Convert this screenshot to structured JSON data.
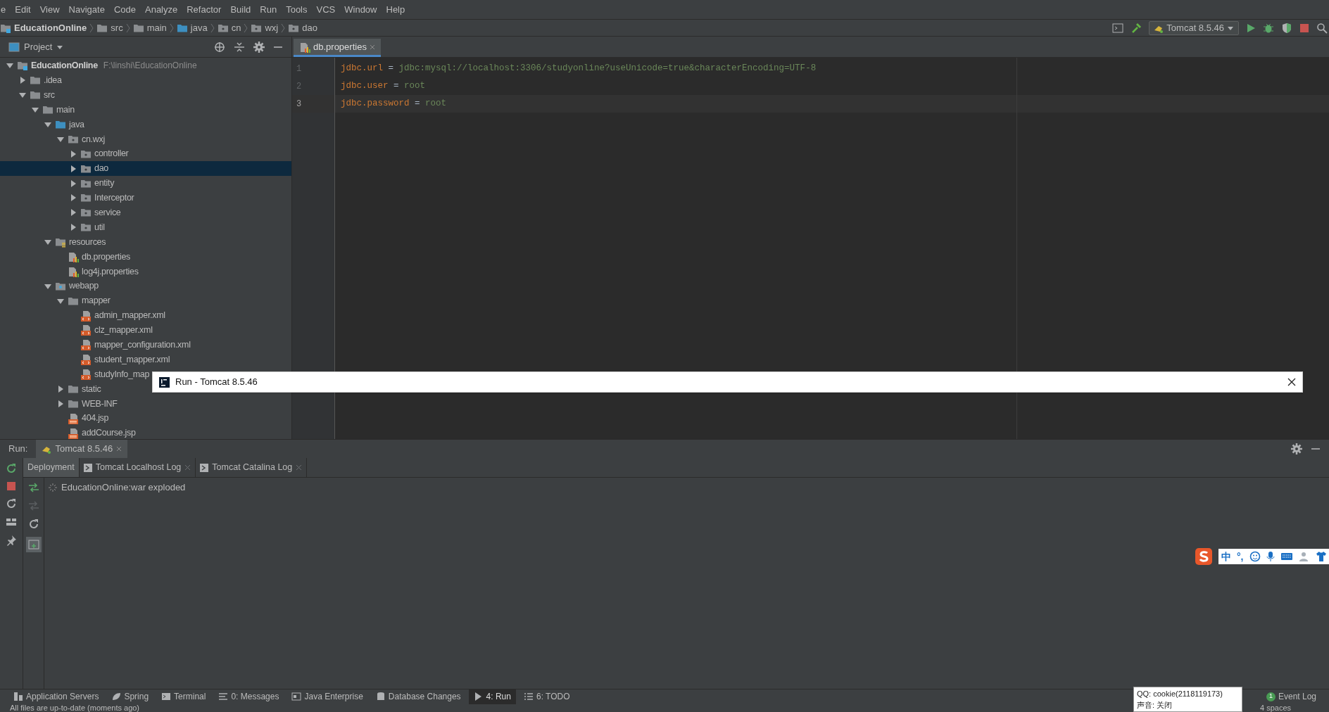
{
  "menu": [
    "e",
    "Edit",
    "View",
    "Navigate",
    "Code",
    "Analyze",
    "Refactor",
    "Build",
    "Run",
    "Tools",
    "VCS",
    "Window",
    "Help"
  ],
  "breadcrumb": [
    "EducationOnline",
    "src",
    "main",
    "java",
    "cn",
    "wxj",
    "dao"
  ],
  "run_config": "Tomcat 8.5.46",
  "project_panel": {
    "title": "Project",
    "tree": [
      {
        "label": "EducationOnline",
        "path": "F:\\linshi\\EducationOnline",
        "kind": "module",
        "expanded": true,
        "selected": false,
        "children": [
          {
            "label": ".idea",
            "kind": "folder",
            "expanded": false,
            "selected": false
          },
          {
            "label": "src",
            "kind": "folder",
            "expanded": true,
            "selected": false,
            "children": [
              {
                "label": "main",
                "kind": "folder",
                "expanded": true,
                "selected": false,
                "children": [
                  {
                    "label": "java",
                    "kind": "source",
                    "expanded": true,
                    "selected": false,
                    "children": [
                      {
                        "label": "cn.wxj",
                        "kind": "package",
                        "expanded": true,
                        "selected": false,
                        "children": [
                          {
                            "label": "controller",
                            "kind": "package",
                            "expanded": false,
                            "selected": false
                          },
                          {
                            "label": "dao",
                            "kind": "package",
                            "expanded": false,
                            "selected": true
                          },
                          {
                            "label": "entity",
                            "kind": "package",
                            "expanded": false,
                            "selected": false
                          },
                          {
                            "label": "Interceptor",
                            "kind": "package",
                            "expanded": false,
                            "selected": false
                          },
                          {
                            "label": "service",
                            "kind": "package",
                            "expanded": false,
                            "selected": false
                          },
                          {
                            "label": "util",
                            "kind": "package",
                            "expanded": false,
                            "selected": false
                          }
                        ]
                      }
                    ]
                  },
                  {
                    "label": "resources",
                    "kind": "resources",
                    "expanded": true,
                    "selected": false,
                    "children": [
                      {
                        "label": "db.properties",
                        "kind": "properties",
                        "selected": false
                      },
                      {
                        "label": "log4j.properties",
                        "kind": "properties",
                        "selected": false
                      }
                    ]
                  },
                  {
                    "label": "webapp",
                    "kind": "web",
                    "expanded": true,
                    "selected": false,
                    "children": [
                      {
                        "label": "mapper",
                        "kind": "folder",
                        "expanded": true,
                        "selected": false,
                        "children": [
                          {
                            "label": "admin_mapper.xml",
                            "kind": "xml",
                            "selected": false
                          },
                          {
                            "label": "clz_mapper.xml",
                            "kind": "xml",
                            "selected": false
                          },
                          {
                            "label": "mapper_configuration.xml",
                            "kind": "xml",
                            "selected": false
                          },
                          {
                            "label": "student_mapper.xml",
                            "kind": "xml",
                            "selected": false
                          },
                          {
                            "label": "studyInfo_map",
                            "kind": "xml",
                            "selected": false
                          }
                        ]
                      },
                      {
                        "label": "static",
                        "kind": "folder",
                        "expanded": false,
                        "selected": false
                      },
                      {
                        "label": "WEB-INF",
                        "kind": "folder",
                        "expanded": false,
                        "selected": false
                      },
                      {
                        "label": "404.jsp",
                        "kind": "jsp",
                        "selected": false
                      },
                      {
                        "label": "addCourse.jsp",
                        "kind": "jsp",
                        "selected": false
                      }
                    ]
                  }
                ]
              }
            ]
          }
        ]
      }
    ]
  },
  "editor": {
    "tab": "db.properties",
    "lines": [
      {
        "number": "1",
        "key": "jdbc.url",
        "sep": "=",
        "value": "jdbc:mysql://localhost:3306/studyonline?useUnicode=true&characterEncoding=UTF-8",
        "current": false
      },
      {
        "number": "2",
        "key": "jdbc.user",
        "sep": "=",
        "value": "root",
        "current": false
      },
      {
        "number": "3",
        "key": "jdbc.password",
        "sep": "=",
        "value": "root",
        "current": true
      }
    ]
  },
  "popup": {
    "title": "Run - Tomcat 8.5.46"
  },
  "run_panel": {
    "label": "Run:",
    "tab": "Tomcat 8.5.46",
    "subtabs": [
      {
        "label": "Deployment",
        "selected": true
      },
      {
        "label": "Tomcat Localhost Log",
        "selected": false
      },
      {
        "label": "Tomcat Catalina Log",
        "selected": false
      }
    ],
    "deployment": "EducationOnline:war exploded"
  },
  "ime": {
    "chars": [
      "中",
      "°,"
    ]
  },
  "tool_windows": [
    {
      "label": "Application Servers",
      "selected": false
    },
    {
      "label": "Spring",
      "selected": false
    },
    {
      "label": "Terminal",
      "selected": false
    },
    {
      "label": "0: Messages",
      "selected": false
    },
    {
      "label": "Java Enterprise",
      "selected": false
    },
    {
      "label": "Database Changes",
      "selected": false
    },
    {
      "label": "4: Run",
      "selected": true
    },
    {
      "label": "6: TODO",
      "selected": false
    }
  ],
  "event_log": {
    "count": "1",
    "label": "Event Log"
  },
  "tooltip": {
    "lines": [
      "QQ: cookie(2118119173)",
      "声音: 关闭"
    ]
  },
  "status": {
    "message": "All files are up-to-date (moments ago)",
    "indent": "4 spaces"
  }
}
